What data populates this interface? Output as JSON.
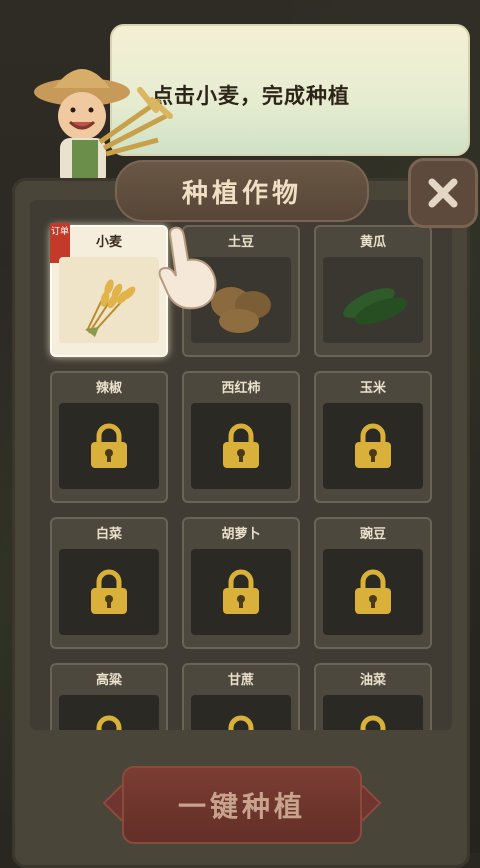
{
  "tooltip": {
    "text": "点击小麦，完成种植"
  },
  "panel": {
    "title": "种植作物"
  },
  "crops": [
    {
      "label": "小麦",
      "tag": "订单",
      "state": "selected"
    },
    {
      "label": "土豆",
      "state": "unlocked"
    },
    {
      "label": "黄瓜",
      "state": "unlocked"
    },
    {
      "label": "辣椒",
      "state": "locked"
    },
    {
      "label": "西红柿",
      "state": "locked"
    },
    {
      "label": "玉米",
      "state": "locked"
    },
    {
      "label": "白菜",
      "state": "locked"
    },
    {
      "label": "胡萝卜",
      "state": "locked"
    },
    {
      "label": "豌豆",
      "state": "locked"
    },
    {
      "label": "高粱",
      "state": "locked"
    },
    {
      "label": "甘蔗",
      "state": "locked"
    },
    {
      "label": "油菜",
      "state": "locked"
    }
  ],
  "bottom_button": {
    "label": "一键种植"
  },
  "icons": {
    "close": "close-icon",
    "lock": "lock-icon",
    "pointer": "pointing-hand-icon"
  },
  "colors": {
    "lock_gold": "#d9b03a",
    "tag_red": "#c43a2a",
    "button_red": "#6e362e"
  }
}
